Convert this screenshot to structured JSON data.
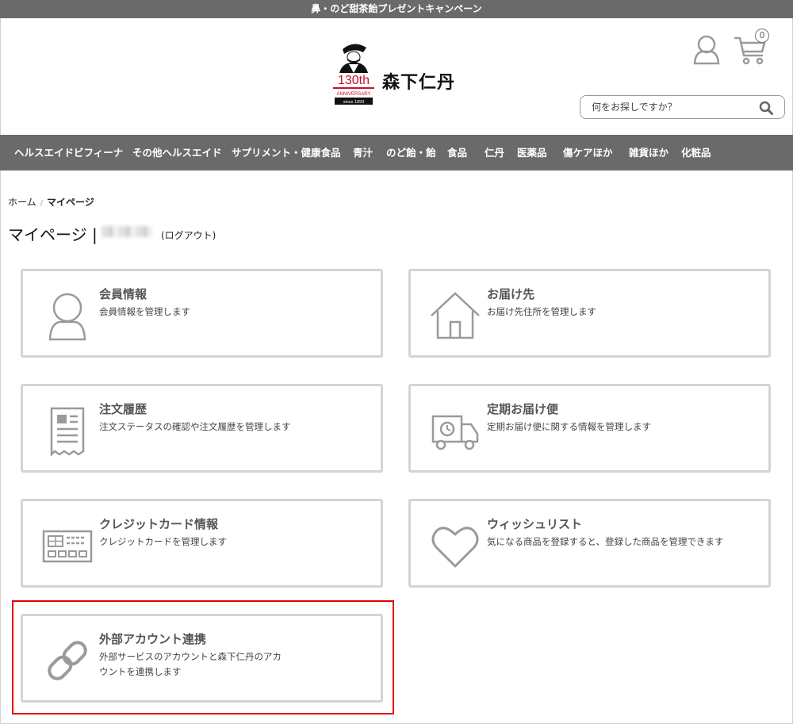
{
  "campaign": {
    "text": "鼻・のど甜茶飴プレゼントキャンペーン"
  },
  "header": {
    "logo_badge": "130th",
    "logo_anniversary": "ANNIVERSARY",
    "logo_since": "since 1893",
    "brand": "森下仁丹",
    "cart_count": "0",
    "search_placeholder": "何をお探しですか？"
  },
  "nav": {
    "items": [
      "ヘルスエイドビフィーナ",
      "その他ヘルスエイド",
      "サプリメント・健康食品",
      "青汁",
      "のど飴・飴",
      "食品",
      "仁丹",
      "医薬品",
      "傷ケアほか",
      "雑貨ほか",
      "化粧品"
    ]
  },
  "breadcrumb": {
    "home": "ホーム",
    "separator": "/",
    "current": "マイページ"
  },
  "page": {
    "title": "マイページ |",
    "logout": "(ログアウト)"
  },
  "cards": [
    {
      "title": "会員情報",
      "desc": "会員情報を管理します",
      "icon": "user-icon"
    },
    {
      "title": "お届け先",
      "desc": "お届け先住所を管理します",
      "icon": "house-icon"
    },
    {
      "title": "注文履歴",
      "desc": "注文ステータスの確認や注文履歴を管理します",
      "icon": "receipt-icon"
    },
    {
      "title": "定期お届け便",
      "desc": "定期お届け便に関する情報を管理します",
      "icon": "delivery-truck-icon"
    },
    {
      "title": "クレジットカード情報",
      "desc": "クレジットカードを管理します",
      "icon": "credit-card-icon"
    },
    {
      "title": "ウィッシュリスト",
      "desc": "気になる商品を登録すると、登録した商品を管理できます",
      "icon": "heart-icon"
    },
    {
      "title": "外部アカウント連携",
      "desc": "外部サービスのアカウントと森下仁丹のアカウントを連携します",
      "icon": "link-icon"
    }
  ],
  "colors": {
    "bar": "#6a6a6a",
    "card_border": "#d4d4d4",
    "icon": "#9a9a9a",
    "highlight": "#e30000",
    "logo_red": "#c8102e"
  }
}
